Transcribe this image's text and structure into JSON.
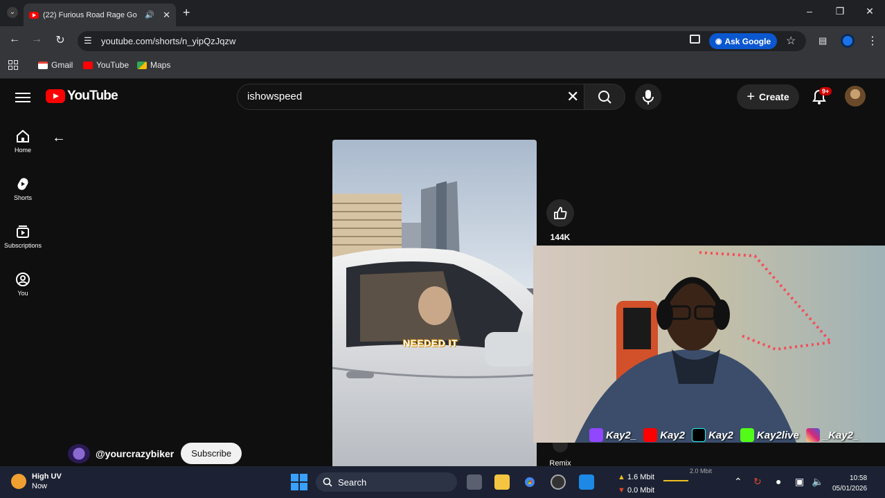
{
  "browser": {
    "tab_title": "(22) Furious Road Rage Go",
    "url": "youtube.com/shorts/n_yipQzJqzw",
    "ask_google": "Ask Google",
    "bookmarks": [
      "Gmail",
      "YouTube",
      "Maps"
    ],
    "icons": [
      "tab-list-icon",
      "audio-icon",
      "close-tab-icon",
      "new-tab-icon",
      "minimize-icon",
      "maximize-icon",
      "close-window-icon",
      "back-icon",
      "forward-icon",
      "reload-icon",
      "site-info-icon",
      "install-icon",
      "star-icon",
      "profile-icon",
      "menu-icon",
      "apps-icon"
    ]
  },
  "youtube": {
    "logo_text": "YouTube",
    "search_value": "ishowspeed",
    "create_label": "Create",
    "notifications_badge": "9+",
    "sidebar": [
      {
        "label": "Home",
        "icon": "home-icon"
      },
      {
        "label": "Shorts",
        "icon": "shorts-icon"
      },
      {
        "label": "Subscriptions",
        "icon": "subscriptions-icon"
      },
      {
        "label": "You",
        "icon": "you-icon"
      }
    ],
    "video_caption": "NEEDED IT",
    "like_count": "144K",
    "remix_label": "Remix",
    "channel_name": "@yourcrazybiker",
    "subscribe_label": "Subscribe"
  },
  "stream_overlay": {
    "socials": [
      {
        "platform": "twitch",
        "handle": "Kay2_",
        "color": "#9146ff"
      },
      {
        "platform": "youtube",
        "handle": "Kay2",
        "color": "#ff0000"
      },
      {
        "platform": "tiktok",
        "handle": "Kay2",
        "color": "#000000"
      },
      {
        "platform": "kick",
        "handle": "Kay2live",
        "color": "#53fc18"
      },
      {
        "platform": "instagram",
        "handle": "_Kay2_",
        "color": "#d6249f"
      }
    ]
  },
  "taskbar": {
    "weather_title": "High UV",
    "weather_sub": "Now",
    "search_label": "Search",
    "upload": "1.6 Mbit",
    "download": "0.0 Mbit",
    "graph_label": "2.0 Mbit",
    "time": "10:58",
    "date": "05/01/2026"
  },
  "colors": {
    "yt_bg": "#0f0f0f",
    "yt_red": "#ff0000",
    "chrome_dark": "#202124",
    "chrome_toolbar": "#35363a",
    "ask_google_blue": "#0b57d0"
  }
}
